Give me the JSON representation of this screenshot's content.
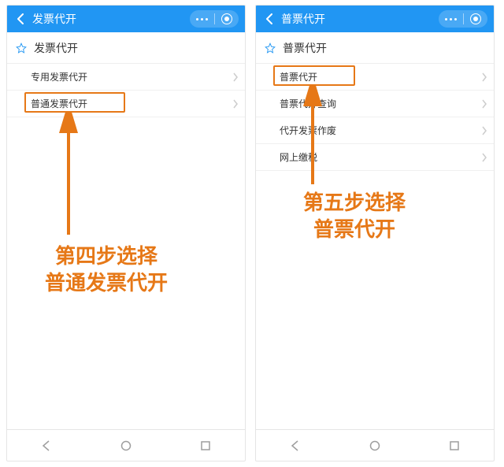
{
  "left": {
    "header_title": "发票代开",
    "section_title": "发票代开",
    "items": [
      {
        "label": "专用发票代开"
      },
      {
        "label": "普通发票代开"
      }
    ],
    "annotation": {
      "line1": "第四步选择",
      "line2": "普通发票代开"
    }
  },
  "right": {
    "header_title": "普票代开",
    "section_title": "普票代开",
    "items": [
      {
        "label": "普票代开"
      },
      {
        "label": "普票代开查询"
      },
      {
        "label": "代开发票作废"
      },
      {
        "label": "网上缴税"
      }
    ],
    "annotation": {
      "line1": "第五步选择",
      "line2": "普票代开"
    }
  },
  "colors": {
    "accent": "#2196f3",
    "highlight": "#e67817"
  }
}
